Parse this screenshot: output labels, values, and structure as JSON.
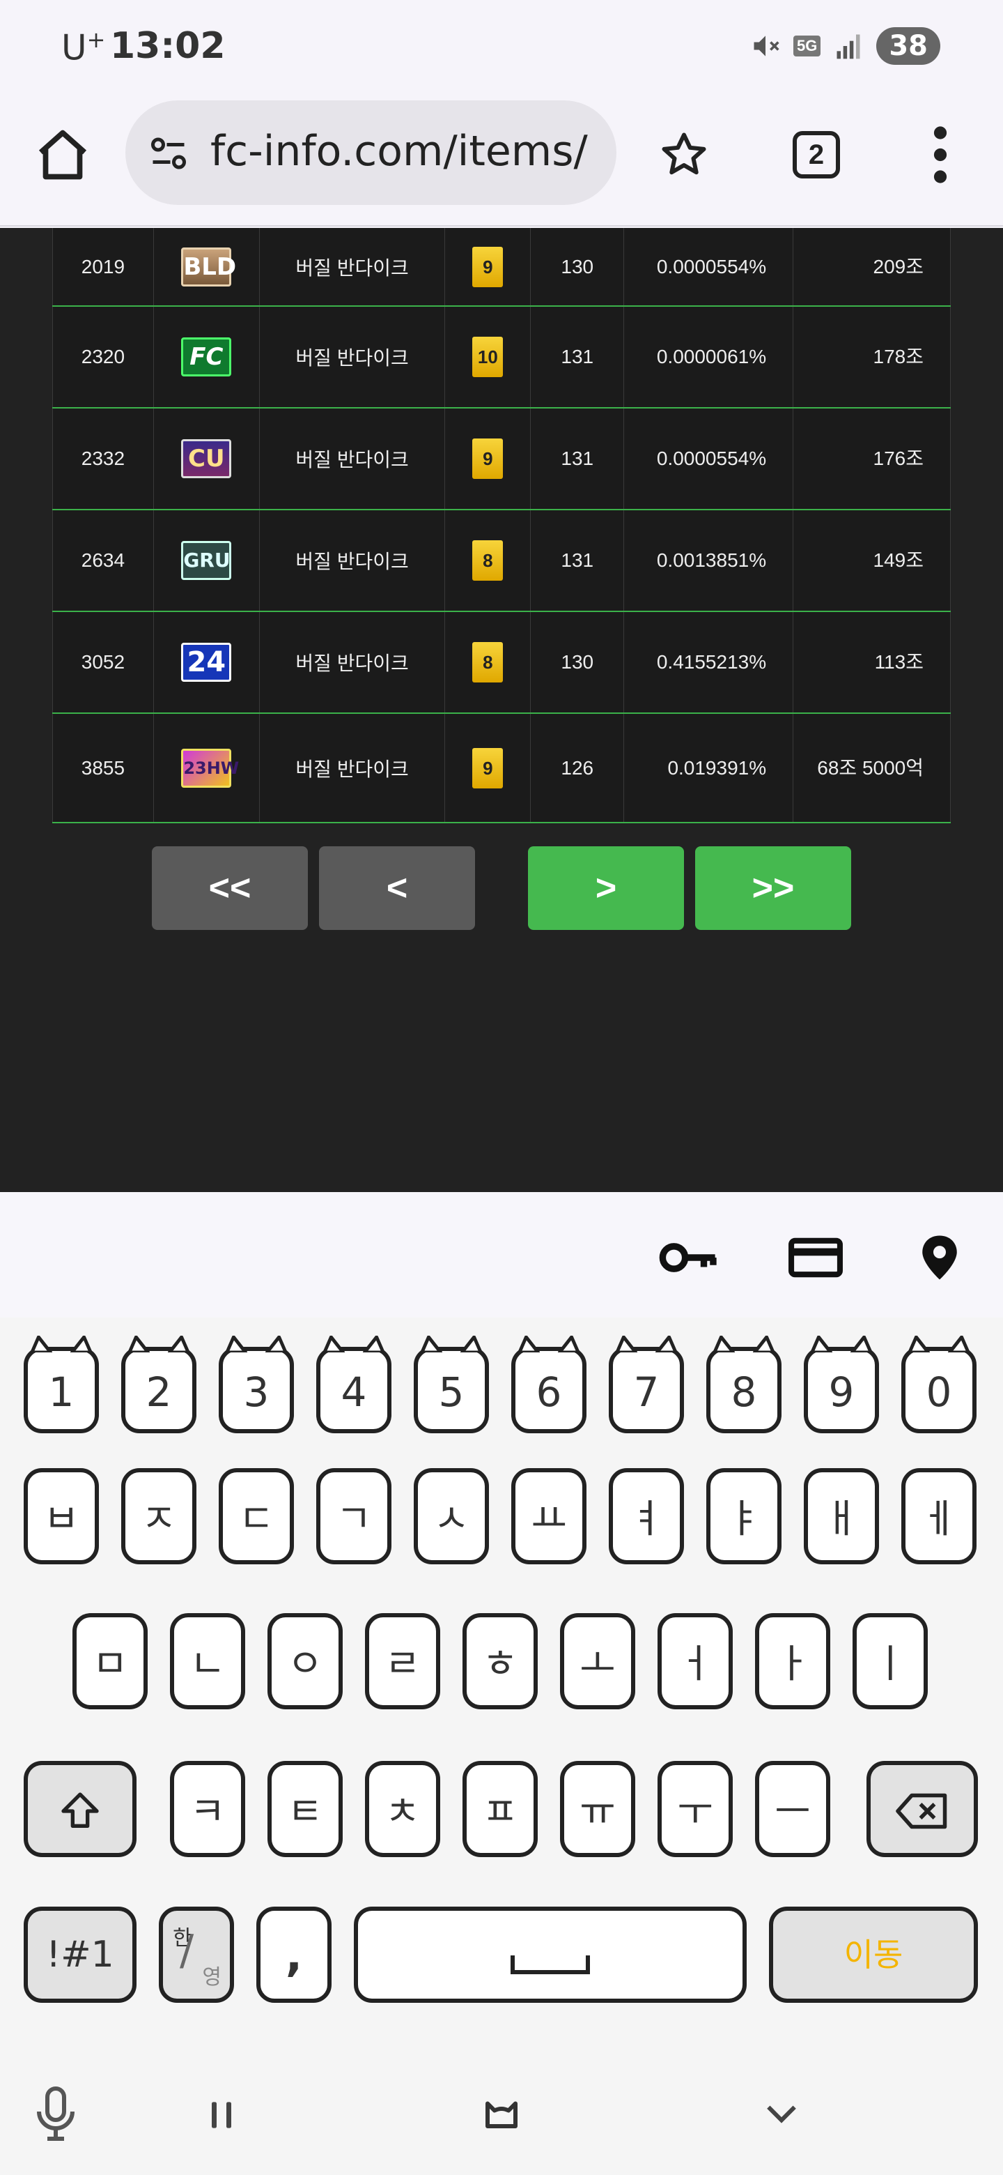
{
  "status_bar": {
    "carrier": "U",
    "carrier_sup": "+",
    "time": "13:02",
    "network": "5G",
    "battery": "38"
  },
  "browser": {
    "url": "fc-info.com/items/",
    "tab_count": "2"
  },
  "table": {
    "rows": [
      {
        "rank": "2019",
        "season": "BLD",
        "name": "버질 반다이크",
        "grade": "9",
        "ovr": "130",
        "rate": "0.0000554%",
        "price": "209조"
      },
      {
        "rank": "2320",
        "season": "FC",
        "name": "버질 반다이크",
        "grade": "10",
        "ovr": "131",
        "rate": "0.0000061%",
        "price": "178조"
      },
      {
        "rank": "2332",
        "season": "CU",
        "name": "버질 반다이크",
        "grade": "9",
        "ovr": "131",
        "rate": "0.0000554%",
        "price": "176조"
      },
      {
        "rank": "2634",
        "season": "GRU",
        "name": "버질 반다이크",
        "grade": "8",
        "ovr": "131",
        "rate": "0.0013851%",
        "price": "149조"
      },
      {
        "rank": "3052",
        "season": "24",
        "name": "버질 반다이크",
        "grade": "8",
        "ovr": "130",
        "rate": "0.4155213%",
        "price": "113조"
      },
      {
        "rank": "3855",
        "season": "23HW",
        "name": "버질 반다이크",
        "grade": "9",
        "ovr": "126",
        "rate": "0.019391%",
        "price": "68조 5000억"
      }
    ]
  },
  "pagination": {
    "first": "<<",
    "prev": "<",
    "next": ">",
    "last": ">>"
  },
  "autofill": {
    "icons": [
      "key-icon",
      "credit-card-icon",
      "location-pin-icon"
    ]
  },
  "keyboard": {
    "row_numbers": [
      "1",
      "2",
      "3",
      "4",
      "5",
      "6",
      "7",
      "8",
      "9",
      "0"
    ],
    "row1": [
      "ㅂ",
      "ㅈ",
      "ㄷ",
      "ㄱ",
      "ㅅ",
      "ㅛ",
      "ㅕ",
      "ㅑ",
      "ㅐ",
      "ㅔ"
    ],
    "row2": [
      "ㅁ",
      "ㄴ",
      "ㅇ",
      "ㄹ",
      "ㅎ",
      "ㅗ",
      "ㅓ",
      "ㅏ",
      "ㅣ"
    ],
    "row3": [
      "ㅋ",
      "ㅌ",
      "ㅊ",
      "ㅍ",
      "ㅠ",
      "ㅜ",
      "ㅡ"
    ],
    "symbols_label": "!#1",
    "lang_top": "한",
    "lang_bottom": "영",
    "comma": ",",
    "enter_label": "이동",
    "enter_color": "#f4b400"
  },
  "colors": {
    "page_bg": "#222222",
    "row_border": "#3bb24a",
    "pager_active": "#45b94f",
    "pager_disabled": "#5a5a5a"
  }
}
